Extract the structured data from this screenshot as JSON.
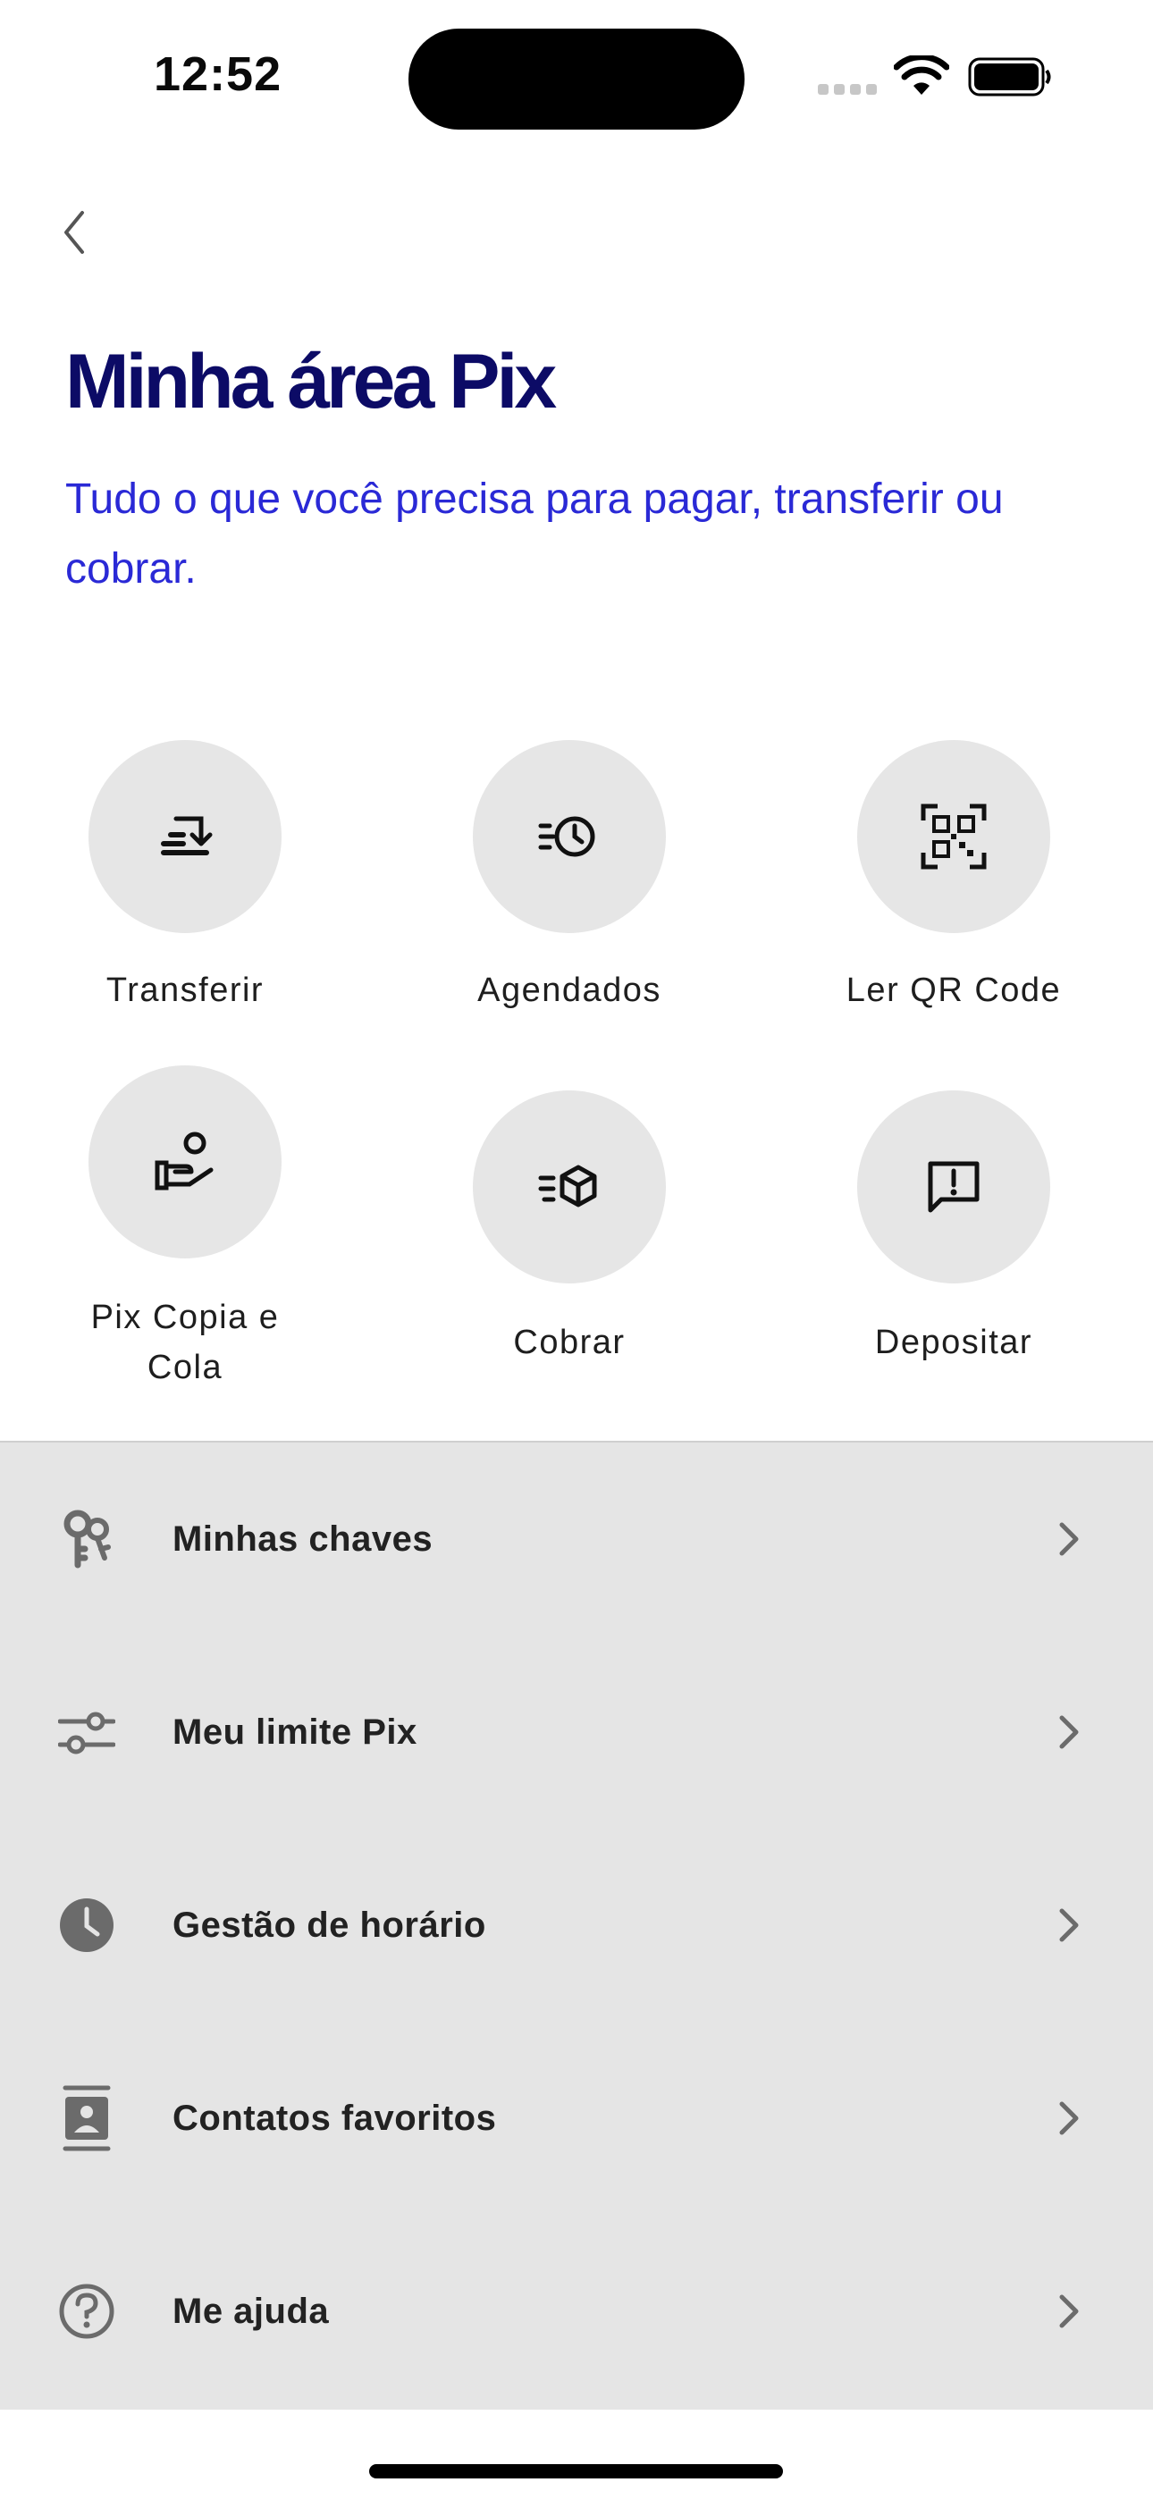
{
  "status_bar": {
    "time": "12:52"
  },
  "header": {
    "title": "Minha área Pix",
    "subtitle": "Tudo o que você precisa para pagar, transferir ou cobrar."
  },
  "actions": [
    {
      "label": "Transferir",
      "icon": "transfer-icon"
    },
    {
      "label": "Agendados",
      "icon": "scheduled-clock-icon"
    },
    {
      "label": "Ler QR Code",
      "icon": "qr-code-icon"
    },
    {
      "label": "Pix Copia e Cola",
      "icon": "hand-person-icon"
    },
    {
      "label": "Cobrar",
      "icon": "box-delivery-icon"
    },
    {
      "label": "Depositar",
      "icon": "message-alert-icon"
    }
  ],
  "menu": [
    {
      "label": "Minhas chaves",
      "icon": "keys-icon"
    },
    {
      "label": "Meu limite Pix",
      "icon": "sliders-icon"
    },
    {
      "label": "Gestão de horário",
      "icon": "clock-icon"
    },
    {
      "label": "Contatos favoritos",
      "icon": "contact-book-icon"
    },
    {
      "label": "Me ajuda",
      "icon": "help-icon"
    }
  ],
  "colors": {
    "title": "#0c0b66",
    "subtitle": "#2a29d6",
    "action_circle": "#e6e6e6",
    "menu_background": "#e5e5e5"
  }
}
